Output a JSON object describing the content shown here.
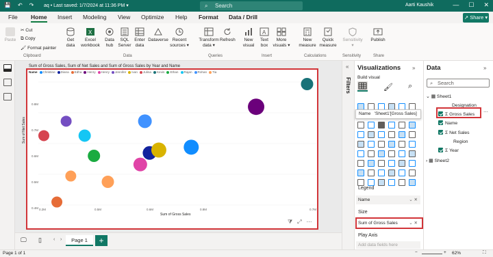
{
  "titlebar": {
    "file_title": "aq • Last saved: 1/7/2024 at 11:36 PM",
    "search_placeholder": "Search",
    "user": "Aarti Kaushik",
    "dropdown": "▾"
  },
  "tabs": [
    "File",
    "Home",
    "Insert",
    "Modeling",
    "View",
    "Optimize",
    "Help",
    "Format",
    "Data / Drill"
  ],
  "share_label": "Share",
  "ribbon": {
    "clipboard": {
      "paste": "Paste",
      "cut": "Cut",
      "copy": "Copy",
      "format_painter": "Format painter",
      "group": "Clipboard"
    },
    "data": {
      "get_data": "Get data",
      "excel": "Excel workbook",
      "hub": "Data hub",
      "sql": "SQL Server",
      "enter": "Enter data",
      "dataverse": "Dataverse",
      "recent": "Recent sources",
      "group": "Data"
    },
    "queries": {
      "transform": "Transform data",
      "refresh": "Refresh",
      "group": "Queries"
    },
    "insert": {
      "new_visual": "New visual",
      "text_box": "Text box",
      "more_visuals": "More visuals",
      "group": "Insert"
    },
    "calculations": {
      "new_measure": "New measure",
      "quick_measure": "Quick measure",
      "group": "Calculations"
    },
    "sensitivity": {
      "label": "Sensitivity",
      "group": "Sensitivity"
    },
    "share": {
      "publish": "Publish",
      "group": "Share"
    }
  },
  "visual": {
    "title": "Sum of Gross Sales, Sum of Net Sales and Sum of Gross Sales by Year and Name",
    "legend_title": "Name",
    "footer_icons": [
      "filter-icon",
      "focus-mode-icon",
      "more-options-icon"
    ]
  },
  "chart_data": {
    "type": "scatter",
    "xlabel": "Sum of Gross Sales",
    "ylabel": "Sum of Net Sales",
    "x_ticks": [
      "0.2M",
      "0.5M",
      "0.6M",
      "0.8M",
      "0.7M"
    ],
    "y_ticks": [
      "0.8M",
      "0.7M",
      "0.6M",
      "0.5M",
      "0.4M"
    ],
    "legend": [
      {
        "name": "Christine",
        "color": "#118dff"
      },
      {
        "name": "Diana",
        "color": "#12239e"
      },
      {
        "name": "Edha",
        "color": "#e66c37"
      },
      {
        "name": "Henry",
        "color": "#6b007b"
      },
      {
        "name": "Henry",
        "color": "#e044a7"
      },
      {
        "name": "Jennifer",
        "color": "#744ec2"
      },
      {
        "name": "Ivan",
        "color": "#d9b300"
      },
      {
        "name": "Julina",
        "color": "#d64550"
      },
      {
        "name": "Kevin",
        "color": "#197278"
      },
      {
        "name": "Ethan",
        "color": "#1aab40"
      },
      {
        "name": "Rajan",
        "color": "#15c6f4"
      },
      {
        "name": "Rohan",
        "color": "#4092ff"
      },
      {
        "name": "Tia",
        "color": "#ffa058"
      }
    ],
    "points": [
      {
        "x": 0.2,
        "y": 0.65,
        "r": 8,
        "color": "#d64550"
      },
      {
        "x": 0.24,
        "y": 0.42,
        "r": 8,
        "color": "#e66c37"
      },
      {
        "x": 0.27,
        "y": 0.51,
        "r": 8,
        "color": "#ffa058"
      },
      {
        "x": 0.26,
        "y": 0.7,
        "r": 8,
        "color": "#744ec2"
      },
      {
        "x": 0.3,
        "y": 0.65,
        "r": 9,
        "color": "#15c6f4"
      },
      {
        "x": 0.32,
        "y": 0.58,
        "r": 9,
        "color": "#1aab40"
      },
      {
        "x": 0.35,
        "y": 0.49,
        "r": 9,
        "color": "#ffa058"
      },
      {
        "x": 0.42,
        "y": 0.55,
        "r": 10,
        "color": "#e044a7"
      },
      {
        "x": 0.43,
        "y": 0.7,
        "r": 10,
        "color": "#4092ff"
      },
      {
        "x": 0.44,
        "y": 0.59,
        "r": 10,
        "color": "#12239e"
      },
      {
        "x": 0.46,
        "y": 0.6,
        "r": 11,
        "color": "#d9b300"
      },
      {
        "x": 0.53,
        "y": 0.61,
        "r": 11,
        "color": "#118dff"
      },
      {
        "x": 0.67,
        "y": 0.75,
        "r": 12,
        "color": "#6b007b"
      },
      {
        "x": 0.78,
        "y": 0.83,
        "r": 9,
        "color": "#197278"
      }
    ]
  },
  "pages": {
    "tab": "Page 1",
    "add": "+"
  },
  "status": {
    "page": "Page 1 of 1",
    "zoom": "62%"
  },
  "filters_label": "Filters",
  "viz_pane": {
    "title": "Visualizations",
    "build_visual": "Build visual",
    "tooltip_name": "Name",
    "tooltip_value": "'Sheet1'[Gross Sales]",
    "legend_label": "Legend",
    "legend_value": "Name",
    "size_label": "Size",
    "size_value": "Sum of Gross Sales",
    "play_axis_label": "Play Axis",
    "play_axis_value": "Add data fields here",
    "well_actions": "⌄ ✕"
  },
  "data_pane": {
    "title": "Data",
    "search_placeholder": "Search",
    "table": "Sheet1",
    "table2": "Sheet2",
    "fields": [
      {
        "label": "Designation",
        "checked": false,
        "sigma": false
      },
      {
        "label": "Gross Sales",
        "checked": true,
        "sigma": true
      },
      {
        "label": "Name",
        "checked": true,
        "sigma": false
      },
      {
        "label": "Net Sales",
        "checked": true,
        "sigma": true
      },
      {
        "label": "Region",
        "checked": false,
        "sigma": false
      },
      {
        "label": "Year",
        "checked": true,
        "sigma": true
      }
    ]
  }
}
